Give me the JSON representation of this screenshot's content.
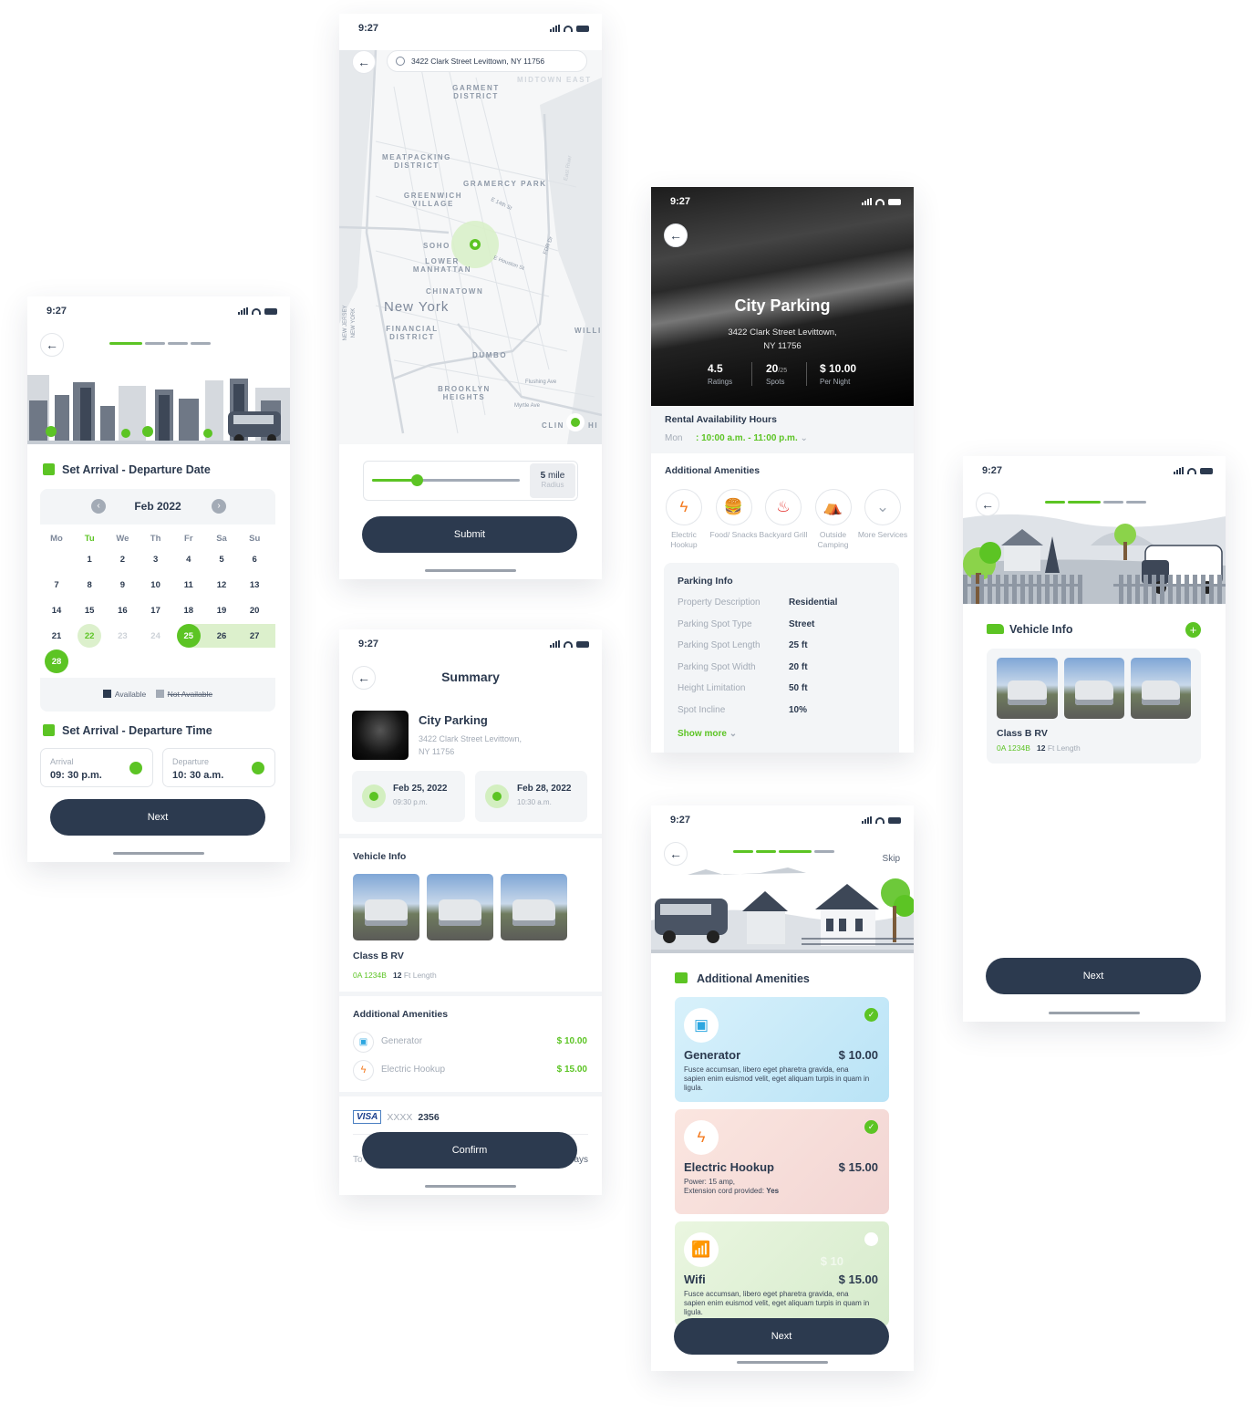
{
  "status_time": "9:27",
  "colors": {
    "primary": "#2c3a4f",
    "accent_green": "#5cc424",
    "muted": "#a3abb6",
    "panel": "#f3f5f7"
  },
  "date_screen": {
    "date_title": "Set Arrival - Departure Date",
    "month": "Feb 2022",
    "weekdays": [
      "Mo",
      "Tu",
      "We",
      "Th",
      "Fr",
      "Sa",
      "Su"
    ],
    "highlight_weekday": "Tu",
    "weeks": [
      [
        null,
        "1",
        "2",
        "3",
        "4",
        "5",
        "6"
      ],
      [
        "7",
        "8",
        "9",
        "10",
        "11",
        "12",
        "13"
      ],
      [
        "14",
        "15",
        "16",
        "17",
        "18",
        "19",
        "20"
      ],
      [
        "21",
        "22",
        "23",
        "24",
        "25",
        "26",
        "27"
      ],
      [
        "28",
        null,
        null,
        null,
        null,
        null,
        null
      ]
    ],
    "day_states": {
      "22": "today",
      "23": "unavailable",
      "24": "unavailable",
      "25": "start",
      "26": "range",
      "27": "range",
      "28": "end"
    },
    "legend_available": "Available",
    "legend_not_available": "Not Available",
    "time_title": "Set Arrival - Departure Time",
    "arrival_label": "Arrival",
    "arrival_value": "09: 30 p.m.",
    "departure_label": "Departure",
    "departure_value": "10: 30 a.m.",
    "next_label": "Next",
    "progress_step": 1,
    "progress_total": 4
  },
  "map_screen": {
    "search_value": "3422 Clark Street Levittown, NY 11756",
    "labels": {
      "midtown_east": "MIDTOWN EAST",
      "garment": "GARMENT DISTRICT",
      "meatpacking": "MEATPACKING DISTRICT",
      "gramercy": "GRAMERCY PARK",
      "greenwich": "GREENWICH VILLAGE",
      "soho": "SOHO",
      "lower_manhattan": "LOWER MANHATTAN",
      "chinatown": "CHINATOWN",
      "new_york": "New York",
      "financial": "FINANCIAL DISTRICT",
      "dumbo": "DUMBO",
      "brooklyn_heights": "BROOKLYN HEIGHTS",
      "willi": "WILLI",
      "clin": "CLIN",
      "hi": "HI",
      "nj_ny": "NEW JERSEY NEW YORK",
      "fdr": "FDR Dr",
      "e14": "E 14th St",
      "houston": "E Houston St",
      "flushing": "Flushing Ave",
      "myrtle": "Myrtle Ave",
      "east_river": "East River"
    },
    "radius_value": "5",
    "radius_unit": "mile",
    "radius_label": "Radius",
    "radius_fraction": 0.3,
    "submit_label": "Submit"
  },
  "summary_screen": {
    "title": "Summary",
    "parking_name": "City Parking",
    "address_line1": "3422 Clark Street Levittown,",
    "address_line2": "NY 11756",
    "arrival_date": "Feb 25, 2022",
    "arrival_time": "09:30 p.m.",
    "departure_date": "Feb 28, 2022",
    "departure_time": "10:30 a.m.",
    "vehicle_title": "Vehicle Info",
    "vehicle_name": "Class B RV",
    "plate": "0A 1234B",
    "length_value": "12",
    "length_unit": "Ft Length",
    "amenities_title": "Additional Amenities",
    "amenities": [
      {
        "name": "Generator",
        "price": "$ 10.00",
        "icon": "generator-icon"
      },
      {
        "name": "Electric Hookup",
        "price": "$ 15.00",
        "icon": "electric-hookup-icon"
      }
    ],
    "card_brand": "VISA",
    "card_mask": "XXXX",
    "card_last4": "2356",
    "total_partial_left": "To",
    "total_partial_right": "ays",
    "confirm_label": "Confirm"
  },
  "detail_screen": {
    "name": "City Parking",
    "address_line1": "3422 Clark Street Levittown,",
    "address_line2": "NY 11756",
    "rating": "4.5",
    "rating_label": "Ratings",
    "spots": "20",
    "spots_total": "/25",
    "spots_label": "Spots",
    "price": "$ 10.00",
    "price_label": "Per Night",
    "hours_title": "Rental Availability Hours",
    "hours_day": "Mon",
    "hours_value": ": 10:00 a.m. - 11:00 p.m.",
    "amenities_title": "Additional Amenities",
    "amenities": [
      {
        "label": "Electric Hookup",
        "icon": "electric-hookup-icon",
        "color": "#f47b20"
      },
      {
        "label": "Food/ Snacks",
        "icon": "food-icon",
        "color": "#f4c430"
      },
      {
        "label": "Backyard Grill",
        "icon": "grill-icon",
        "color": "#e53935"
      },
      {
        "label": "Outside Camping",
        "icon": "tent-icon",
        "color": "#3cc6b8"
      },
      {
        "label": "More Services",
        "icon": "chevron-down-icon",
        "color": "#a3abb6"
      }
    ],
    "info_title": "Parking Info",
    "info": [
      {
        "key": "Property Description",
        "value": "Residential"
      },
      {
        "key": "Parking Spot Type",
        "value": "Street"
      },
      {
        "key": "Parking Spot Length",
        "value": "25 ft"
      },
      {
        "key": "Parking Spot Width",
        "value": "20 ft"
      },
      {
        "key": "Height Limitation",
        "value": "50 ft"
      },
      {
        "key": "Spot Incline",
        "value": "10%"
      }
    ],
    "show_more": "Show more"
  },
  "amenities_screen": {
    "skip_label": "Skip",
    "title": "Additional Amenities",
    "progress_step": 3,
    "progress_total": 4,
    "cards": [
      {
        "name": "Generator",
        "price": "$ 10.00",
        "desc": "Fusce accumsan, libero eget pharetra gravida, ena sapien enim euismod velit, eget aliquam turpis in quam in ligula.",
        "selected": true,
        "icon": "generator-icon"
      },
      {
        "name": "Electric Hookup",
        "price": "$ 15.00",
        "desc_line1": "Power: 15 amp,",
        "desc_line2_key": "Extension cord provided:",
        "desc_line2_val": "Yes",
        "selected": true,
        "icon": "electric-hookup-icon"
      },
      {
        "name": "Wifi",
        "price": "$ 15.00",
        "desc": "Fusce accumsan, libero eget pharetra gravida, ena sapien enim euismod velit, eget aliquam turpis in quam in ligula.",
        "ghost": "$ 10",
        "selected": false,
        "icon": "wifi-phone-icon"
      }
    ],
    "next_label": "Next"
  },
  "vehicle_screen": {
    "title": "Vehicle Info",
    "vehicle_name": "Class B RV",
    "plate": "0A 1234B",
    "length_value": "12",
    "length_unit": "Ft Length",
    "next_label": "Next",
    "progress_step": 2,
    "progress_total": 4
  }
}
